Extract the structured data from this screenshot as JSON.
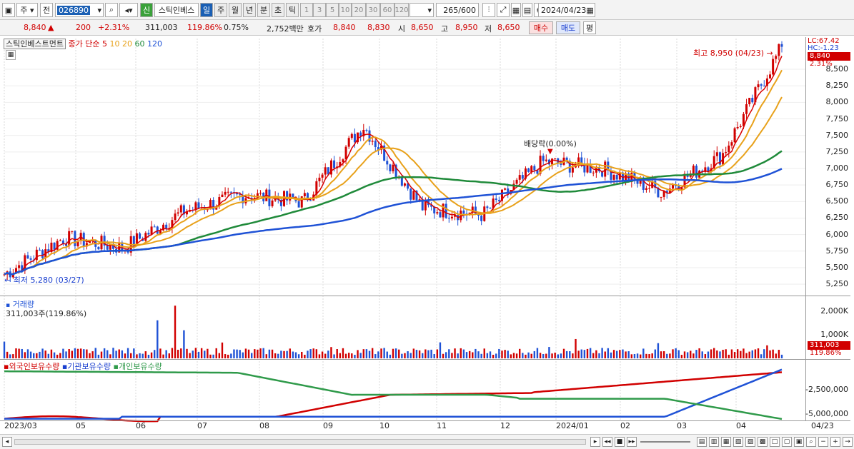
{
  "toolbar": {
    "market": "주",
    "prev_label": "전",
    "code": "026890",
    "stock_name": "스틱인베스",
    "periods": [
      "일",
      "주",
      "월",
      "년",
      "분",
      "초",
      "틱"
    ],
    "active_period": "일",
    "intervals": [
      "1",
      "3",
      "5",
      "10",
      "20",
      "30",
      "60",
      "120"
    ],
    "count": "265",
    "count_total": "/600",
    "date": "2024/04/23",
    "credit_badge": "신"
  },
  "quote": {
    "price": "8,840",
    "change_arrow": "▲",
    "change": "200",
    "change_pct": "+2.31%",
    "volume": "311,003",
    "volume_ratio": "119.86%",
    "turnover": "0.75%",
    "amount": "2,752백만",
    "bid_label": "호가",
    "ask": "8,840",
    "bid": "8,830",
    "open_label": "시",
    "open": "8,650",
    "high_label": "고",
    "high": "8,950",
    "low_label": "저",
    "low": "8,650",
    "buy": "매수",
    "sell": "매도",
    "avg": "평"
  },
  "price_panel": {
    "legend_name": "스틱인베스트먼트",
    "legend_series": "종가 단순",
    "ma": [
      "5",
      "10",
      "20",
      "60",
      "120"
    ],
    "ma_colors": [
      "#d80000",
      "#e8a11a",
      "#e8a11a",
      "#1f8a3a",
      "#1f52d6"
    ],
    "high_note": "최고 8,950 (04/23)",
    "low_note": "최저 5,280 (03/27)",
    "event_note": "배당락(0.00%)",
    "lc": "LC:67.42",
    "hc": "HC:-1.23",
    "last_price_tag": "8,840",
    "last_pct_tag": "2.31%",
    "y_ticks": [
      "8,500",
      "8,250",
      "8,000",
      "7,750",
      "7,500",
      "7,250",
      "7,000",
      "6,750",
      "6,500",
      "6,250",
      "6,000",
      "5,750",
      "5,500",
      "5,250"
    ]
  },
  "volume_panel": {
    "title": "거래량",
    "value": "311,003주(119.86%)",
    "y_ticks": [
      "2,000K",
      "1,000K"
    ],
    "tag_value": "311,003",
    "tag_pct": "119.86%"
  },
  "holding_panel": {
    "series": [
      "외국인보유수량",
      "기관보유수량",
      "개인보유수량"
    ],
    "series_colors": [
      "#d10000",
      "#1f52d6",
      "#2f9a4a"
    ],
    "y_ticks": [
      "-2,500,000",
      "-5,000,000"
    ]
  },
  "x_axis": [
    "2023/03",
    "05",
    "06",
    "07",
    "08",
    "09",
    "10",
    "11",
    "12",
    "2024/01",
    "02",
    "03",
    "04",
    "04/23"
  ],
  "chart_data": {
    "type": "candlestick",
    "start": "2023/03",
    "end": "2024/04/23",
    "close_monthly": [
      {
        "month": "2023/03",
        "close": 5400
      },
      {
        "month": "2023/04",
        "close": 5950
      },
      {
        "month": "2023/05",
        "close": 5800
      },
      {
        "month": "2023/06",
        "close": 6350
      },
      {
        "month": "2023/07",
        "close": 6600
      },
      {
        "month": "2023/08",
        "close": 6500
      },
      {
        "month": "2023/09",
        "close": 7650
      },
      {
        "month": "2023/10",
        "close": 6400
      },
      {
        "month": "2023/11",
        "close": 6300
      },
      {
        "month": "2023/12",
        "close": 7100
      },
      {
        "month": "2024/01",
        "close": 7000
      },
      {
        "month": "2024/02",
        "close": 6650
      },
      {
        "month": "2024/03",
        "close": 7200
      },
      {
        "month": "2024/04",
        "close": 8840
      }
    ],
    "high": 8950,
    "low": 5280,
    "ylim": [
      5100,
      8900
    ]
  }
}
